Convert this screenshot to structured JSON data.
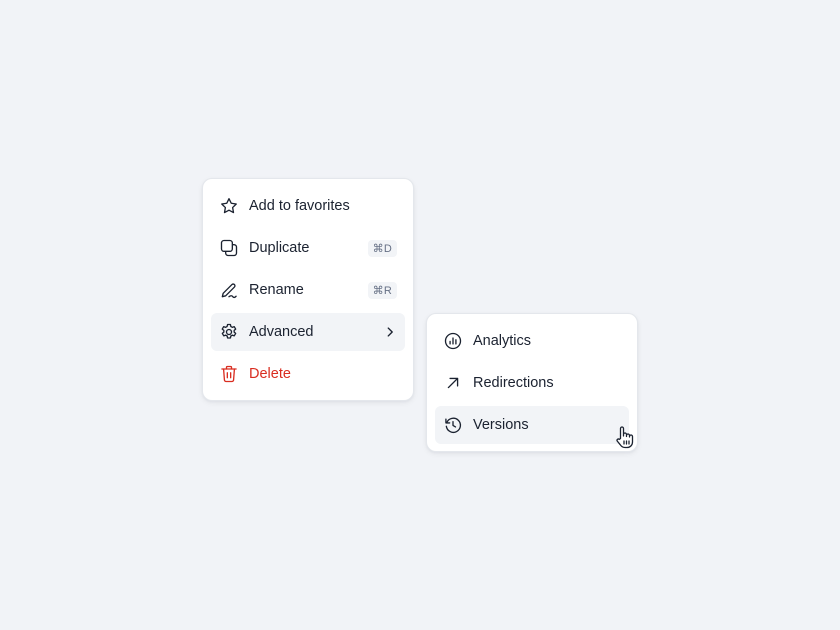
{
  "main_menu": {
    "items": [
      {
        "label": "Add to favorites",
        "icon": "star-icon",
        "shortcut": ""
      },
      {
        "label": "Duplicate",
        "icon": "duplicate-icon",
        "shortcut": "⌘D"
      },
      {
        "label": "Rename",
        "icon": "pencil-icon",
        "shortcut": "⌘R"
      },
      {
        "label": "Advanced",
        "icon": "gear-icon",
        "submenu": true,
        "active": true
      },
      {
        "label": "Delete",
        "icon": "trash-icon",
        "danger": true
      }
    ]
  },
  "sub_menu": {
    "items": [
      {
        "label": "Analytics",
        "icon": "analytics-icon"
      },
      {
        "label": "Redirections",
        "icon": "arrow-up-right-icon"
      },
      {
        "label": "Versions",
        "icon": "history-icon",
        "active": true
      }
    ]
  },
  "colors": {
    "background": "#f1f3f7",
    "text": "#1b2230",
    "danger": "#d92d20",
    "hover": "#f2f4f7"
  }
}
